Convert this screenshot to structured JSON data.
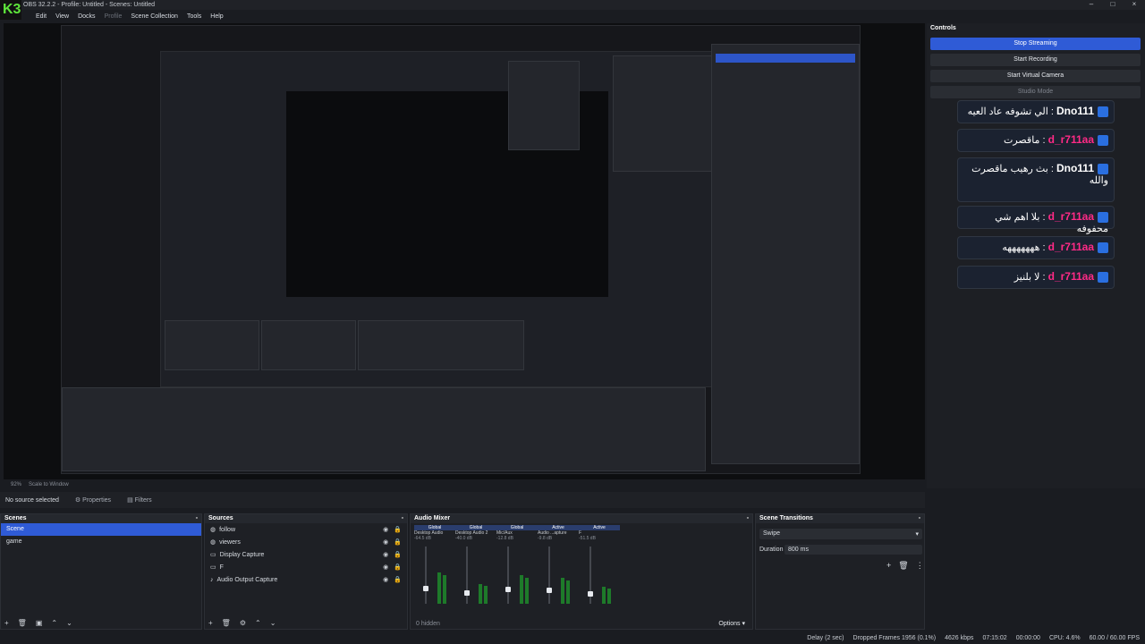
{
  "window": {
    "title": "OBS 32.2.2 - Profile: Untitled - Scenes: Untitled",
    "logo": "K3",
    "controls": [
      "–",
      "□",
      "×"
    ]
  },
  "menu": [
    "Edit",
    "View",
    "Docks",
    "Profile",
    "Scene Collection",
    "Tools",
    "Help"
  ],
  "controls": {
    "header": "Controls",
    "stop_streaming": "Stop Streaming",
    "start_recording": "Start Recording",
    "start_virtual_camera": "Start Virtual Camera",
    "studio_mode": "Studio Mode"
  },
  "chat": [
    {
      "user": "Dno111",
      "message": "الي تشوفه عاد العيه"
    },
    {
      "user": "d_r711aa",
      "message": "ماقصرت"
    },
    {
      "user": "Dno111",
      "message": "بث رهيب ماقصرت والله"
    },
    {
      "user": "d_r711aa",
      "message": "بلا اهم شي محفوفه"
    },
    {
      "user": "d_r711aa",
      "message": "هههههههه"
    },
    {
      "user": "d_r711aa",
      "message": "لا بلنيز"
    }
  ],
  "preview_bar": {
    "zoom": "92%",
    "scale": "Scale to Window"
  },
  "source_bar": {
    "no_source": "No source selected",
    "properties": "Properties",
    "filters": "Filters"
  },
  "scenes": {
    "header": "Scenes",
    "items": [
      "Scene",
      "game"
    ]
  },
  "sources": {
    "header": "Sources",
    "items": [
      "follow",
      "viewers",
      "Display Capture",
      "F",
      "Audio Output Capture"
    ]
  },
  "audio_mixer": {
    "header": "Audio Mixer",
    "channels": [
      {
        "tag": "Global",
        "name": "Desktop Audio",
        "db": "-64.5 dB",
        "level": 0.55
      },
      {
        "tag": "Global",
        "name": "Desktop Audio 2",
        "db": "-40.0 dB",
        "level": 0.35
      },
      {
        "tag": "Global",
        "name": "Mic/Aux",
        "db": "-12.8 dB",
        "level": 0.5
      },
      {
        "tag": "Active",
        "name": "Audio ...apture",
        "db": "-9.8 dB",
        "level": 0.45
      },
      {
        "tag": "Active",
        "name": "F",
        "db": "-51.5 dB",
        "level": 0.3
      }
    ],
    "hidden": "0 hidden",
    "options": "Options"
  },
  "transitions": {
    "header": "Scene Transitions",
    "type": "Swipe",
    "duration_label": "Duration",
    "duration": "800 ms"
  },
  "status": {
    "delay": "Delay (2 sec)",
    "dropped": "Dropped Frames 1956 (0.1%)",
    "kbps": "4626 kbps",
    "time": "07:15:02",
    "rec": "00:00:00",
    "cpu": "CPU: 4.6%",
    "fps": "60.00 / 60.00 FPS"
  },
  "colors": {
    "accent": "#2f5bd6",
    "kick": "#2a6fe0",
    "user": "#ff2a86"
  }
}
